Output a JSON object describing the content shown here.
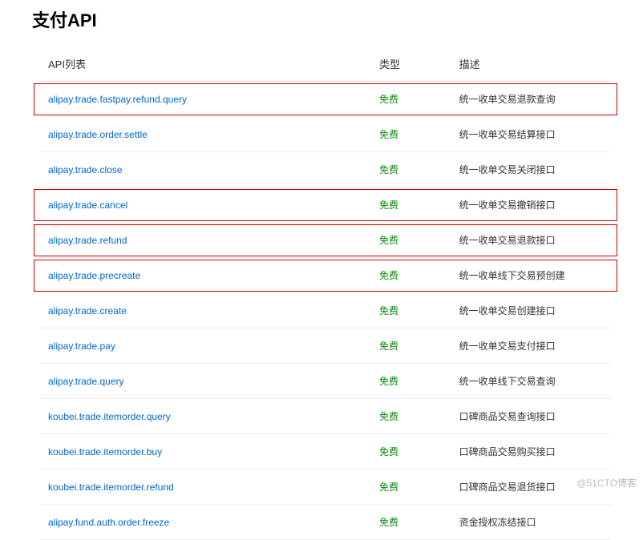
{
  "title": "支付API",
  "columns": {
    "api": "API列表",
    "type": "类型",
    "desc": "描述"
  },
  "rows": [
    {
      "api": "alipay.trade.fastpay.refund.query",
      "type": "免费",
      "desc": "统一收单交易退款查询",
      "hl": true
    },
    {
      "api": "alipay.trade.order.settle",
      "type": "免费",
      "desc": "统一收单交易结算接口",
      "hl": false
    },
    {
      "api": "alipay.trade.close",
      "type": "免费",
      "desc": "统一收单交易关闭接口",
      "hl": false
    },
    {
      "api": "alipay.trade.cancel",
      "type": "免费",
      "desc": "统一收单交易撤销接口",
      "hl": true
    },
    {
      "api": "alipay.trade.refund",
      "type": "免费",
      "desc": "统一收单交易退款接口",
      "hl": true
    },
    {
      "api": "alipay.trade.precreate",
      "type": "免费",
      "desc": "统一收单线下交易预创建",
      "hl": true
    },
    {
      "api": "alipay.trade.create",
      "type": "免费",
      "desc": "统一收单交易创建接口",
      "hl": false
    },
    {
      "api": "alipay.trade.pay",
      "type": "免费",
      "desc": "统一收单交易支付接口",
      "hl": false
    },
    {
      "api": "alipay.trade.query",
      "type": "免费",
      "desc": "统一收单线下交易查询",
      "hl": false
    },
    {
      "api": "koubei.trade.itemorder.query",
      "type": "免费",
      "desc": "口碑商品交易查询接口",
      "hl": false
    },
    {
      "api": "koubei.trade.itemorder.buy",
      "type": "免费",
      "desc": "口碑商品交易购买接口",
      "hl": false
    },
    {
      "api": "koubei.trade.itemorder.refund",
      "type": "免费",
      "desc": "口碑商品交易退货接口",
      "hl": false
    },
    {
      "api": "alipay.fund.auth.order.freeze",
      "type": "免费",
      "desc": "资金授权冻结接口",
      "hl": false
    }
  ],
  "watermark": "@51CTO博客"
}
